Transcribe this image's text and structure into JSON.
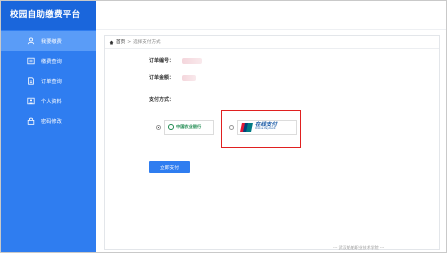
{
  "app": {
    "title": "校园自助缴费平台"
  },
  "sidebar": {
    "items": [
      {
        "label": "我要缴费",
        "icon": "user-icon",
        "active": true
      },
      {
        "label": "缴费查询",
        "icon": "pay-query-icon",
        "active": false
      },
      {
        "label": "订单查询",
        "icon": "order-icon",
        "active": false
      },
      {
        "label": "个人资料",
        "icon": "profile-icon",
        "active": false
      },
      {
        "label": "密码修改",
        "icon": "lock-icon",
        "active": false
      }
    ]
  },
  "breadcrumb": {
    "home": "首页",
    "separator": ">",
    "current": "选择支付方式"
  },
  "order": {
    "number_label": "订单编号：",
    "amount_label": "订单金额：",
    "method_label": "支付方式："
  },
  "payment": {
    "options": [
      {
        "bank": "中国农业银行",
        "checked": true
      },
      {
        "bank": "在线支付",
        "sub": "Online Payment",
        "checked": false
      }
    ],
    "submit_label": "立即支付"
  },
  "footer": {
    "text": "--- 武汉船舶职业技术学院 ---"
  },
  "colors": {
    "sidebar": "#2f7df0",
    "sidebar_header": "#1a66dc",
    "active_item": "#5a9cf7",
    "highlight": "#e02020"
  }
}
